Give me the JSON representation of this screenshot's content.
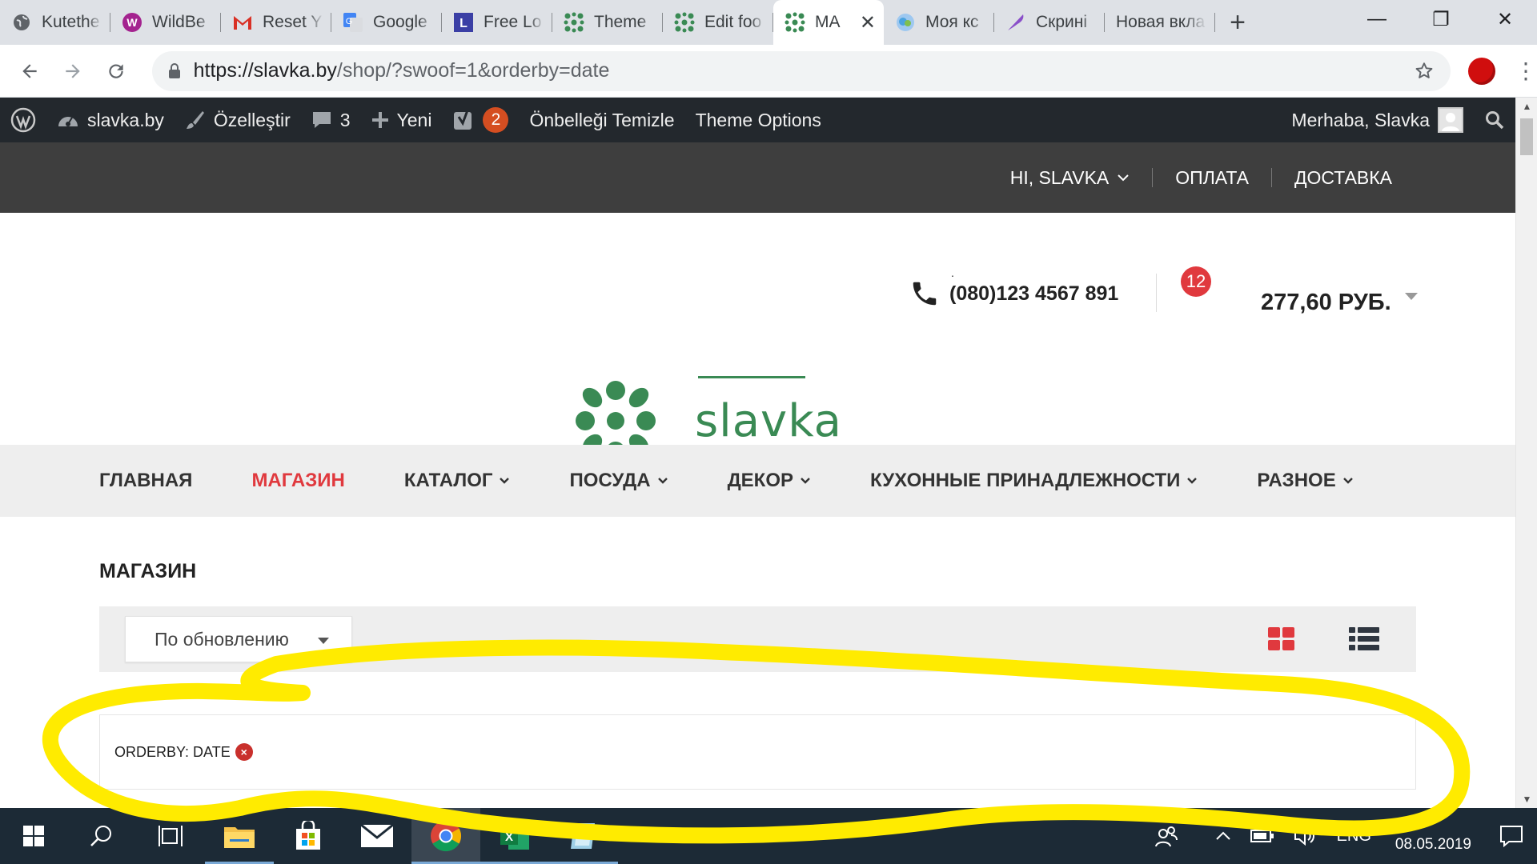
{
  "browser": {
    "tabs": [
      {
        "title": "Kutethe",
        "icon": "globe-icon"
      },
      {
        "title": "WildBe",
        "icon": "wildberries-icon"
      },
      {
        "title": "Reset Y",
        "icon": "gmail-icon"
      },
      {
        "title": "Google",
        "icon": "google-translate-icon"
      },
      {
        "title": "Free Lo",
        "icon": "l-logo-icon"
      },
      {
        "title": "Theme",
        "icon": "slavka-logo-icon"
      },
      {
        "title": "Edit foo",
        "icon": "slavka-logo-icon"
      },
      {
        "title": "MA",
        "icon": "slavka-logo-icon",
        "active": true
      },
      {
        "title": "Моя кс",
        "icon": "cloud-icon"
      },
      {
        "title": "Скрині",
        "icon": "feather-icon"
      },
      {
        "title": "Новая вкла",
        "icon": ""
      }
    ],
    "new_tab_label": "+",
    "close_tab_label": "✕",
    "window": {
      "minimize": "—",
      "maximize": "❐",
      "close": "✕"
    },
    "address": {
      "host": "https://slavka.by",
      "rest": "/shop/?swoof=1&orderby=date"
    }
  },
  "admin_bar": {
    "site_name": "slavka.by",
    "customize": "Özelleştir",
    "comments_count": "3",
    "new_label": "Yeni",
    "yoast_count": "2",
    "clear_cache": "Önbelleği Temizle",
    "theme_options": "Theme Options",
    "greeting": "Merhaba, Slavka"
  },
  "top_bar": {
    "user_menu": "HI, SLAVKA",
    "payment": "ОПЛАТА",
    "delivery": "ДОСТАВКА"
  },
  "header": {
    "logo_text": "slavka",
    "phone_dot": ".",
    "phone": "(080)123 4567 891",
    "cart_count": "12",
    "cart_total": "277,60 РУБ."
  },
  "main_nav": {
    "items": [
      {
        "label": "ГЛАВНАЯ",
        "active": false,
        "dropdown": false
      },
      {
        "label": "МАГАЗИН",
        "active": true,
        "dropdown": false
      },
      {
        "label": "КАТАЛОГ",
        "active": false,
        "dropdown": true
      },
      {
        "label": "ПОСУДА",
        "active": false,
        "dropdown": true
      },
      {
        "label": "ДЕКОР",
        "active": false,
        "dropdown": true
      },
      {
        "label": "КУХОННЫЕ ПРИНАДЛЕЖНОСТИ",
        "active": false,
        "dropdown": true
      },
      {
        "label": "РАЗНОЕ",
        "active": false,
        "dropdown": true
      }
    ]
  },
  "shop": {
    "title": "МАГАЗИН",
    "sort_selected": "По обновлению",
    "active_filter": "ORDERBY: DATE",
    "remove_filter": "×"
  },
  "taskbar": {
    "language": "ENG",
    "date": "08.05.2019"
  },
  "colors": {
    "brand_green": "#3a8a54",
    "accent_red": "#e0393e",
    "admin_bar": "#23282d",
    "top_bar": "#3e3e3e",
    "annotation_yellow": "#ffeb00"
  }
}
